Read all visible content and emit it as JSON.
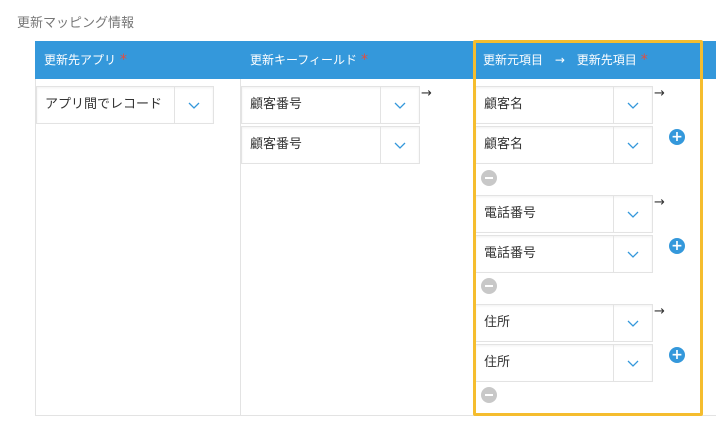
{
  "section": {
    "title": "更新マッピング情報"
  },
  "header": {
    "col1": "更新先アプリ",
    "col2": "更新キーフィールド",
    "col3_left": "更新元項目",
    "col3_arrow": "→",
    "col3_right": "更新先項目",
    "required_mark": "*"
  },
  "target_app": {
    "value": "アプリ間でレコード"
  },
  "key_fields": {
    "source": "顧客番号",
    "dest": "顧客番号"
  },
  "mappings": [
    {
      "source": "顧客名",
      "dest": "顧客名"
    },
    {
      "source": "電話番号",
      "dest": "電話番号"
    },
    {
      "source": "住所",
      "dest": "住所"
    }
  ],
  "glyphs": {
    "arrow": "→",
    "plus": "+"
  },
  "colors": {
    "header_bg": "#3498db",
    "required": "#e74c3c",
    "highlight": "#f5bd2e",
    "chevron": "#3498db"
  }
}
